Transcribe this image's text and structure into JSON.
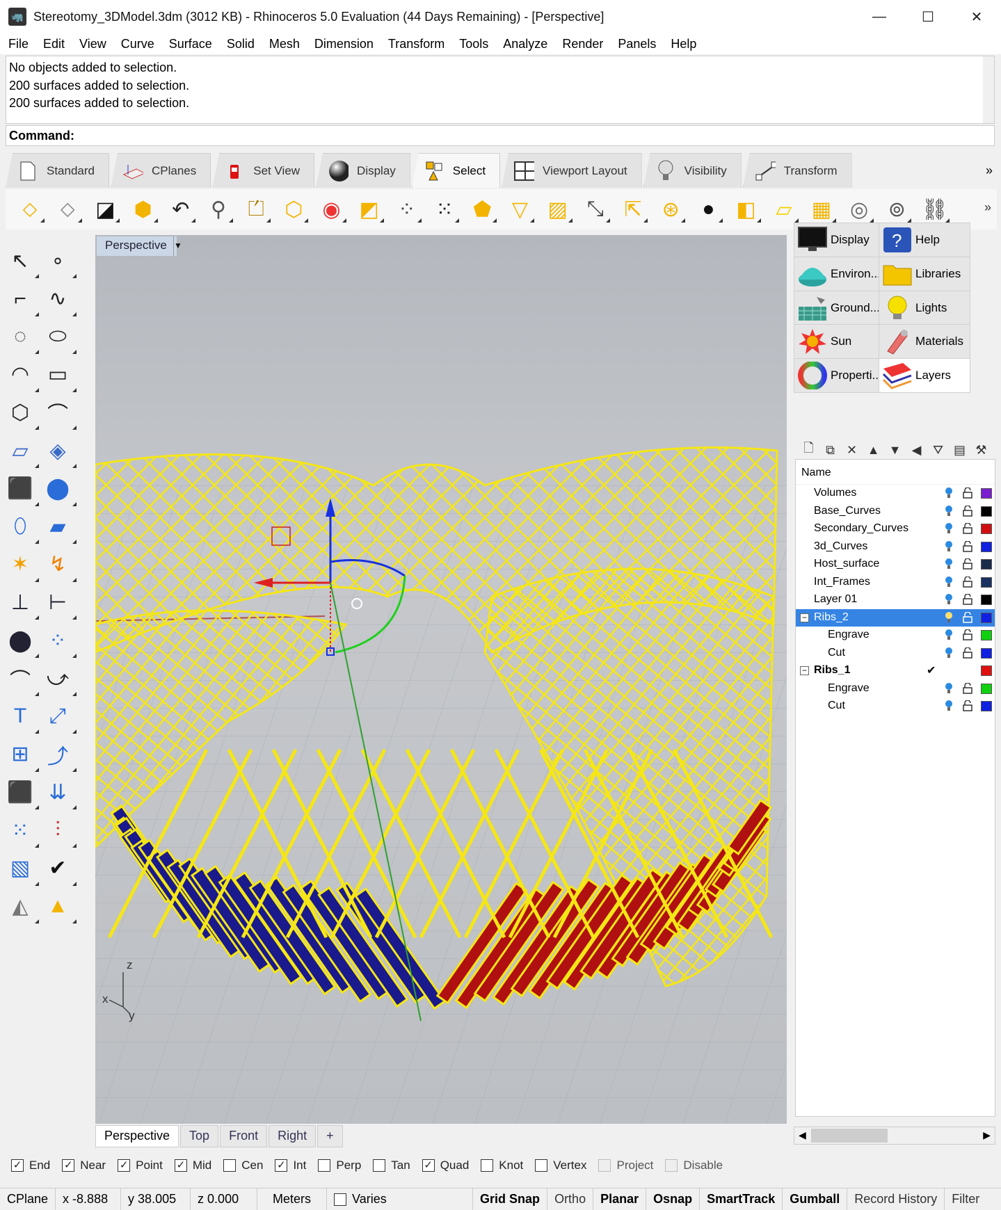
{
  "window": {
    "title": "Stereotomy_3DModel.3dm (3012 KB) - Rhinoceros 5.0 Evaluation (44 Days Remaining) - [Perspective]",
    "minimize": "—",
    "maximize": "☐",
    "close": "✕"
  },
  "menu": [
    "File",
    "Edit",
    "View",
    "Curve",
    "Surface",
    "Solid",
    "Mesh",
    "Dimension",
    "Transform",
    "Tools",
    "Analyze",
    "Render",
    "Panels",
    "Help"
  ],
  "command_history": [
    "No objects added to selection.",
    "200 surfaces added to selection.",
    "200 surfaces added to selection."
  ],
  "command_prompt": "Command:",
  "toolbar_tabs": [
    {
      "label": "Standard",
      "icon": "page-icon"
    },
    {
      "label": "CPlanes",
      "icon": "cplane-icon"
    },
    {
      "label": "Set View",
      "icon": "camera-icon"
    },
    {
      "label": "Display",
      "icon": "sphere-icon"
    },
    {
      "label": "Select",
      "icon": "select-icon"
    },
    {
      "label": "Viewport Layout",
      "icon": "viewport-icon"
    },
    {
      "label": "Visibility",
      "icon": "bulb-icon"
    },
    {
      "label": "Transform",
      "icon": "transform-icon"
    }
  ],
  "toolbar_more": "»",
  "viewport": {
    "label": "Perspective",
    "axis_x": "x",
    "axis_y": "y",
    "axis_z": "z"
  },
  "view_tabs": [
    "Perspective",
    "Top",
    "Front",
    "Right",
    "+"
  ],
  "panel_tabs": [
    {
      "label": "Display",
      "icon": "monitor-icon"
    },
    {
      "label": "Help",
      "icon": "help-icon"
    },
    {
      "label": "Environ...",
      "icon": "environment-icon"
    },
    {
      "label": "Libraries",
      "icon": "folder-icon"
    },
    {
      "label": "Ground...",
      "icon": "ground-icon"
    },
    {
      "label": "Lights",
      "icon": "lightbulb-icon"
    },
    {
      "label": "Sun",
      "icon": "sun-icon"
    },
    {
      "label": "Materials",
      "icon": "materials-icon"
    },
    {
      "label": "Properti...",
      "icon": "properties-icon"
    },
    {
      "label": "Layers",
      "icon": "layers-icon"
    }
  ],
  "layers": {
    "header": "Name",
    "rows": [
      {
        "name": "Volumes",
        "color": "#7a1fd0",
        "indent": 0
      },
      {
        "name": "Base_Curves",
        "color": "#000000",
        "indent": 0
      },
      {
        "name": "Secondary_Curves",
        "color": "#d01010",
        "indent": 0
      },
      {
        "name": "3d_Curves",
        "color": "#1020e0",
        "indent": 0
      },
      {
        "name": "Host_surface",
        "color": "#1a2a4a",
        "indent": 0
      },
      {
        "name": "Int_Frames",
        "color": "#1a3060",
        "indent": 0
      },
      {
        "name": "Layer 01",
        "color": "#000000",
        "indent": 0
      },
      {
        "name": "Ribs_2",
        "color": "#1020e0",
        "indent": 0,
        "selected": true,
        "expand": "−"
      },
      {
        "name": "Engrave",
        "color": "#10d010",
        "indent": 1
      },
      {
        "name": "Cut",
        "color": "#1020e0",
        "indent": 1
      },
      {
        "name": "Ribs_1",
        "color": "#e01010",
        "indent": 0,
        "current": true,
        "expand": "−",
        "check": "✔"
      },
      {
        "name": "Engrave",
        "color": "#10d010",
        "indent": 1
      },
      {
        "name": "Cut",
        "color": "#1020e0",
        "indent": 1
      }
    ]
  },
  "osnaps": [
    {
      "label": "End",
      "checked": true
    },
    {
      "label": "Near",
      "checked": true
    },
    {
      "label": "Point",
      "checked": true
    },
    {
      "label": "Mid",
      "checked": true
    },
    {
      "label": "Cen",
      "checked": false
    },
    {
      "label": "Int",
      "checked": true
    },
    {
      "label": "Perp",
      "checked": false
    },
    {
      "label": "Tan",
      "checked": false
    },
    {
      "label": "Quad",
      "checked": true
    },
    {
      "label": "Knot",
      "checked": false
    },
    {
      "label": "Vertex",
      "checked": false
    },
    {
      "label": "Project",
      "checked": false,
      "disabled": true
    },
    {
      "label": "Disable",
      "checked": false,
      "disabled": true
    }
  ],
  "status": {
    "cplane": "CPlane",
    "x": "x -8.888",
    "y": "y 38.005",
    "z": "z 0.000",
    "units": "Meters",
    "layer": "Varies",
    "grid_snap": "Grid Snap",
    "ortho": "Ortho",
    "planar": "Planar",
    "osnap": "Osnap",
    "smarttrack": "SmartTrack",
    "gumball": "Gumball",
    "record_history": "Record History",
    "filter": "Filter"
  },
  "colors": {
    "accent": "#3584e4",
    "lattice": "#f5e616",
    "rib_blue": "#1a1a8c",
    "rib_red": "#b01010"
  }
}
